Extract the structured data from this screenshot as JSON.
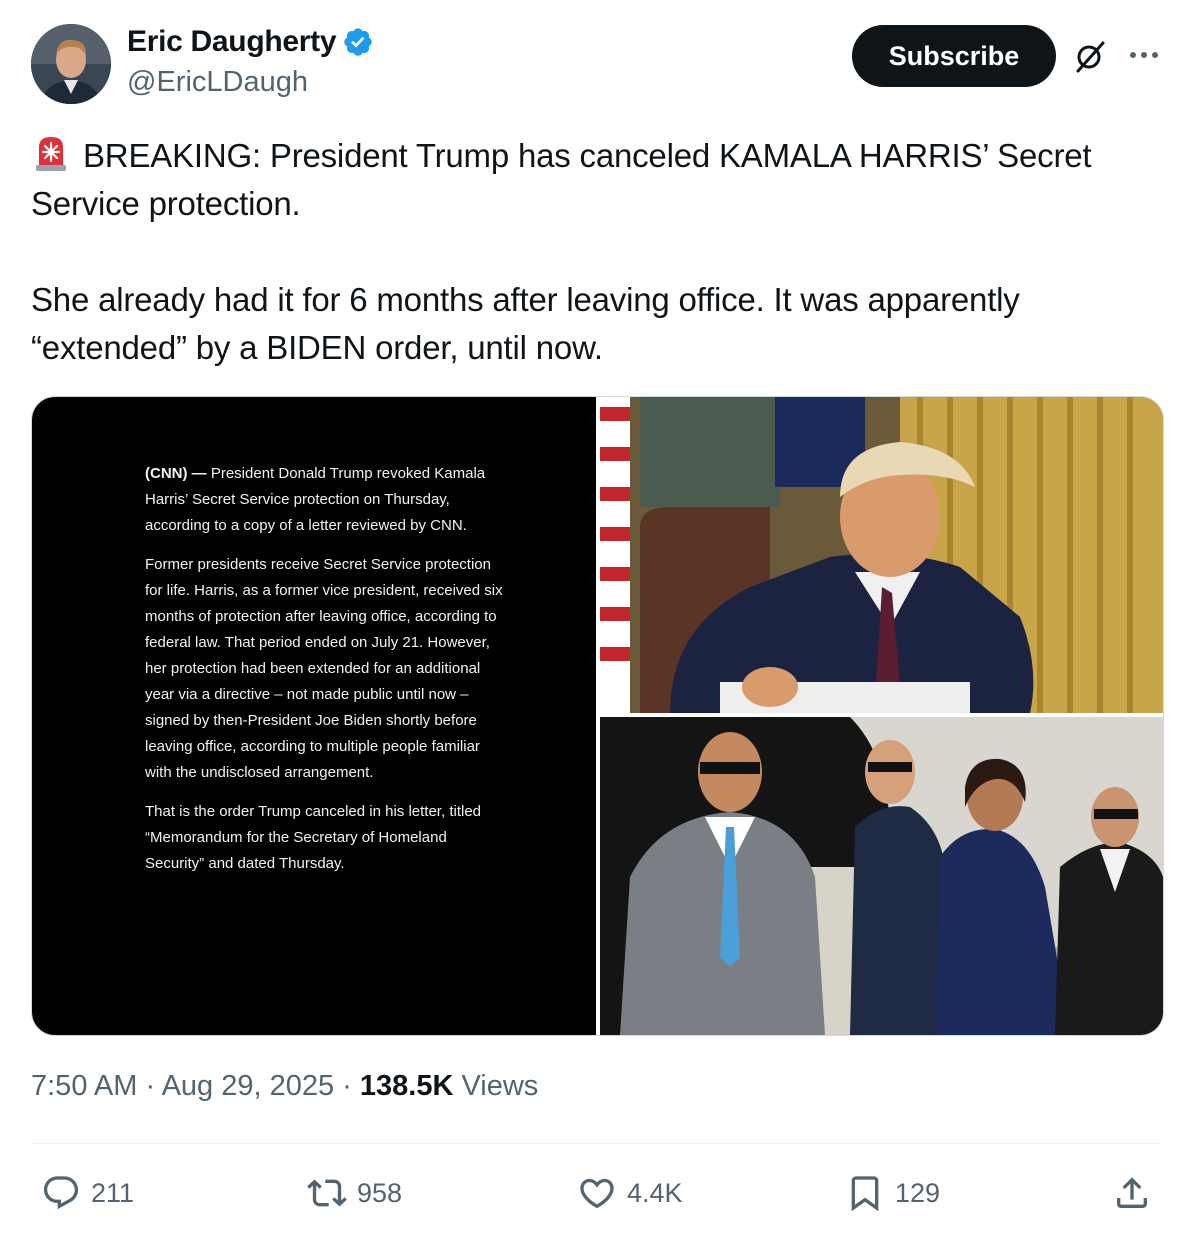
{
  "author": {
    "name": "Eric Daugherty",
    "handle": "@EricLDaugh",
    "verified": true,
    "verified_color": "#1d9bf0"
  },
  "header": {
    "subscribe_label": "Subscribe",
    "icons": [
      "grok-icon",
      "more-icon"
    ]
  },
  "tweet": {
    "line1": "BREAKING: President Trump has canceled KAMALA HARRIS’ Secret Service protection.",
    "line2": "She already had it for 6 months after leaving office. It was apparently “extended” by a BIDEN order, until now.",
    "emoji": "siren-icon"
  },
  "media": {
    "article": {
      "source": "(CNN) —",
      "p1": "President Donald Trump revoked Kamala Harris’ Secret Service protection on Thursday, according to a copy of a letter reviewed by CNN.",
      "p2": "Former presidents receive Secret Service protection for life. Harris, as a former vice president, received six months of protection after leaving office, according to federal law. That period ended on July 21. However, her protection had been extended for an additional year via a directive – not made public until now – signed by then-President Joe Biden shortly before leaving office, according to multiple people familiar with the undisclosed arrangement.",
      "p3": "That is the order Trump canceled in his letter, titled “Memorandum for the Secretary of Homeland Security” and dated Thursday."
    }
  },
  "meta": {
    "time": "7:50 AM",
    "sep1": " · ",
    "date": "Aug 29, 2025",
    "sep2": " · ",
    "views_count": "138.5K",
    "views_label": " Views"
  },
  "actions": {
    "replies": "211",
    "reposts": "958",
    "likes": "4.4K",
    "bookmarks": "129"
  }
}
